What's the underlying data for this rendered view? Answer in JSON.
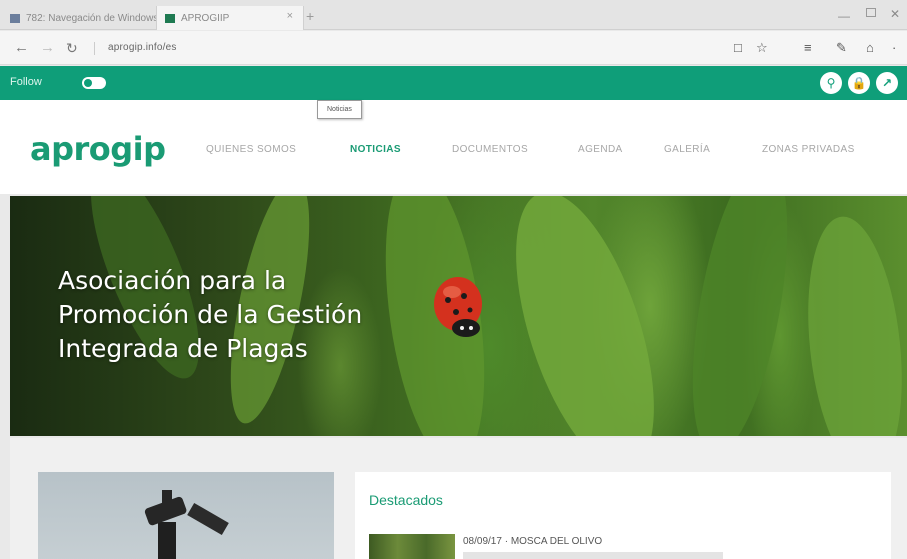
{
  "browser": {
    "tabs": [
      {
        "label": "782: Navegación de Windows",
        "active": false
      },
      {
        "label": "APROGIIP",
        "active": true
      }
    ],
    "tab_close": "×",
    "new_tab": "+",
    "window_controls": {
      "minimize": "—",
      "close": "✕"
    },
    "nav": {
      "back": "←",
      "forward": "→",
      "reload": "↻"
    },
    "url": "aprogip.info/es",
    "toolbar_icons": {
      "reading_view": "□",
      "favorite": "☆",
      "hub": "≡",
      "notes": "✎",
      "share": "⌂",
      "more": "·"
    }
  },
  "site": {
    "topbar": {
      "follow_label": "Follow",
      "bg_color": "#0f9e79",
      "icons": [
        {
          "name": "search-circle-icon",
          "glyph": "⚲"
        },
        {
          "name": "lock-circle-icon",
          "glyph": "🔒"
        },
        {
          "name": "link-circle-icon",
          "glyph": "↗"
        }
      ]
    },
    "logo_text": "aprogip",
    "nav": [
      {
        "label": "QUIENES SOMOS",
        "active": false
      },
      {
        "label": "NOTICIAS",
        "active": true
      },
      {
        "label": "DOCUMENTOS",
        "active": false
      },
      {
        "label": "AGENDA",
        "active": false
      },
      {
        "label": "GALERÍA",
        "active": false
      },
      {
        "label": "ZONAS PRIVADAS",
        "active": false
      }
    ],
    "tooltip": "Noticias",
    "hero": {
      "line1": "Asociación para la",
      "line2": "Promoción de la Gestión",
      "line3": "Integrada de Plagas"
    },
    "featured": {
      "title": "Destacados",
      "news": [
        {
          "date": "08/09/17",
          "headline": "MOSCA DEL OLIVO"
        }
      ]
    },
    "colors": {
      "brand": "#1a9b74",
      "nav_inactive": "#a7a7a7"
    }
  }
}
